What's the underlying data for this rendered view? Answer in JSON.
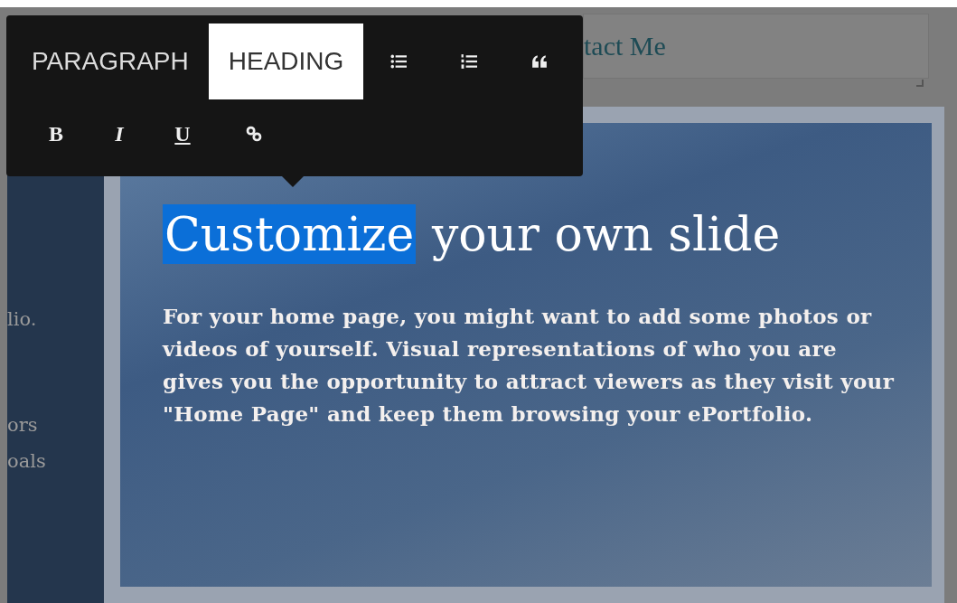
{
  "title_field": {
    "value": "tact Me"
  },
  "toolbar": {
    "block_types": [
      {
        "label": "PARAGRAPH",
        "selected": false
      },
      {
        "label": "HEADING",
        "selected": true
      }
    ],
    "format_buttons": [
      {
        "label": "B",
        "kind": "bold"
      },
      {
        "label": "I",
        "kind": "italic"
      },
      {
        "label": "U",
        "kind": "underline"
      }
    ]
  },
  "side_panel": {
    "lines": [
      "lio.",
      "ors",
      "oals"
    ]
  },
  "slide": {
    "heading": [
      {
        "text": "Customize",
        "selected": true
      },
      {
        "text": "your own slide",
        "selected": false
      }
    ],
    "body": "For your home page, you might want to add some photos or videos of yourself.  Visual representations of who you are gives you the opportunity to attract viewers as they visit your \"Home Page\" and keep them browsing your ePortfolio."
  }
}
